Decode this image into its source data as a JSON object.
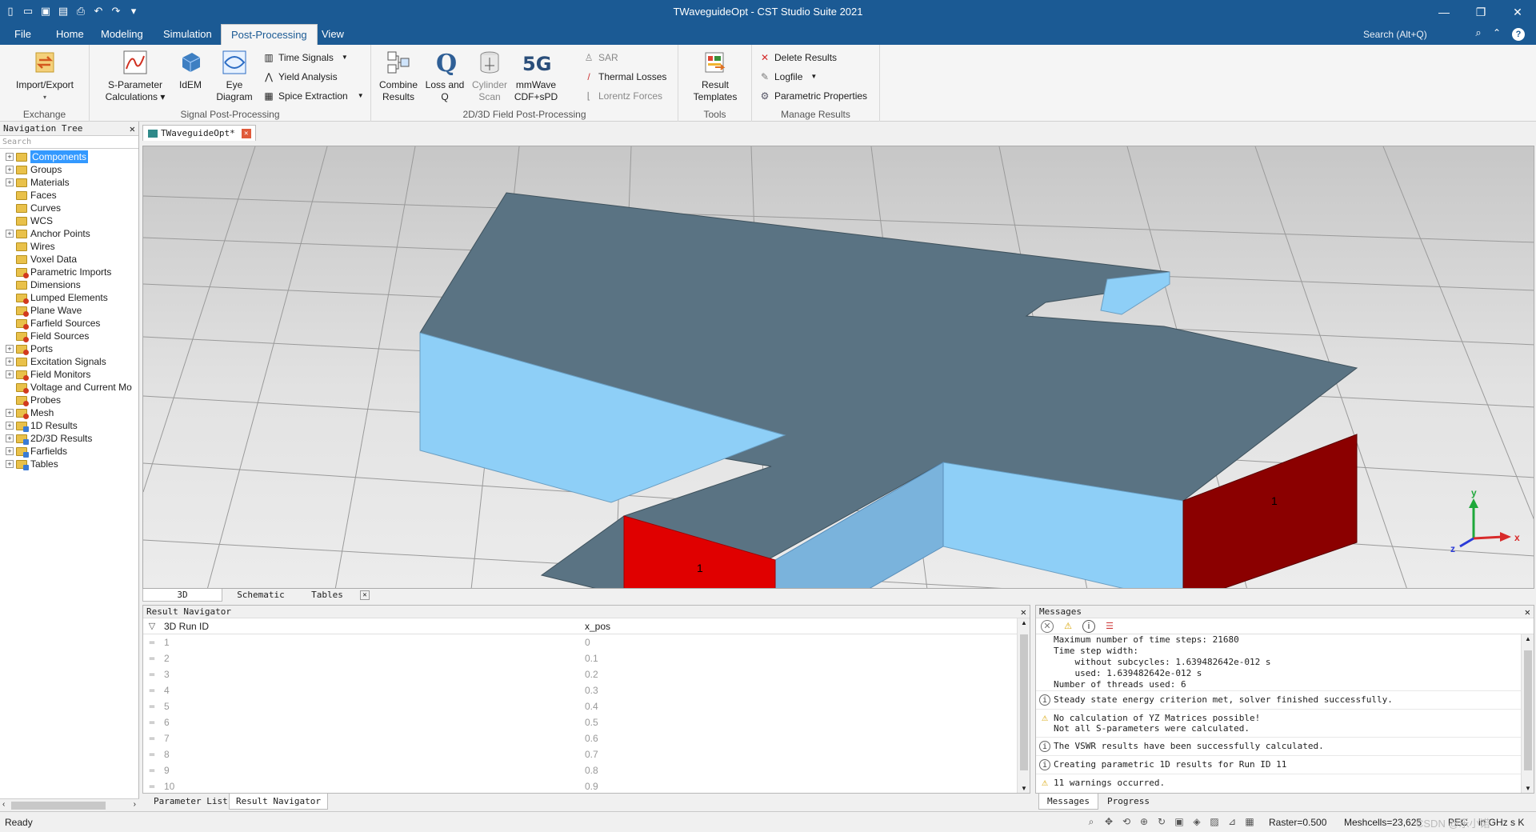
{
  "window": {
    "title": "TWaveguideOpt - CST Studio Suite 2021",
    "qat_icons": [
      "new-icon",
      "open-icon",
      "save-icon",
      "save-all-icon",
      "print-icon",
      "undo-icon",
      "redo-icon",
      "customize-icon"
    ],
    "controls": {
      "minimize": "—",
      "restore": "❐",
      "close": "✕"
    }
  },
  "menu": {
    "tabs": [
      "File",
      "Home",
      "Modeling",
      "Simulation",
      "Post-Processing",
      "View"
    ],
    "active": "Post-Processing",
    "search_placeholder": "Search (Alt+Q)",
    "help": "?"
  },
  "ribbon": {
    "exchange": {
      "import_export": [
        "Import/Export"
      ],
      "label": "Exchange"
    },
    "signal": {
      "sparam": [
        "S-Parameter",
        "Calculations ▾"
      ],
      "idem": [
        "IdEM"
      ],
      "eye": [
        "Eye",
        "Diagram"
      ],
      "time_signals": "Time Signals",
      "yield_analysis": "Yield Analysis",
      "spice_extraction": "Spice Extraction",
      "label": "Signal Post-Processing"
    },
    "field": {
      "combine": [
        "Combine",
        "Results"
      ],
      "loss": [
        "Loss and",
        "Q"
      ],
      "cylinder": [
        "Cylinder",
        "Scan"
      ],
      "mmwave": [
        "mmWave",
        "CDF+sPD"
      ],
      "sar": "SAR",
      "thermal": "Thermal Losses",
      "lorentz": "Lorentz Forces",
      "label": "2D/3D Field Post-Processing"
    },
    "tools": {
      "result_templates": [
        "Result",
        "Templates"
      ],
      "label": "Tools"
    },
    "manage": {
      "delete": "Delete Results",
      "logfile": "Logfile",
      "parametric": "Parametric Properties",
      "label": "Manage Results"
    }
  },
  "nav_tree": {
    "title": "Navigation Tree",
    "search_placeholder": "Search",
    "items": [
      {
        "label": "Components",
        "expandable": true,
        "selected": true,
        "badge": ""
      },
      {
        "label": "Groups",
        "expandable": true,
        "badge": ""
      },
      {
        "label": "Materials",
        "expandable": true,
        "badge": ""
      },
      {
        "label": "Faces",
        "expandable": false,
        "badge": ""
      },
      {
        "label": "Curves",
        "expandable": false,
        "badge": ""
      },
      {
        "label": "WCS",
        "expandable": false,
        "badge": ""
      },
      {
        "label": "Anchor Points",
        "expandable": true,
        "badge": ""
      },
      {
        "label": "Wires",
        "expandable": false,
        "badge": ""
      },
      {
        "label": "Voxel Data",
        "expandable": false,
        "badge": ""
      },
      {
        "label": "Parametric Imports",
        "expandable": false,
        "badge": "red"
      },
      {
        "label": "Dimensions",
        "expandable": false,
        "badge": ""
      },
      {
        "label": "Lumped Elements",
        "expandable": false,
        "badge": "red"
      },
      {
        "label": "Plane Wave",
        "expandable": false,
        "badge": "red"
      },
      {
        "label": "Farfield Sources",
        "expandable": false,
        "badge": "red"
      },
      {
        "label": "Field Sources",
        "expandable": false,
        "badge": "red"
      },
      {
        "label": "Ports",
        "expandable": true,
        "badge": "red"
      },
      {
        "label": "Excitation Signals",
        "expandable": true,
        "badge": ""
      },
      {
        "label": "Field Monitors",
        "expandable": true,
        "badge": "red"
      },
      {
        "label": "Voltage and Current Mo",
        "expandable": false,
        "badge": "red"
      },
      {
        "label": "Probes",
        "expandable": false,
        "badge": "red"
      },
      {
        "label": "Mesh",
        "expandable": true,
        "badge": "red"
      },
      {
        "label": "1D Results",
        "expandable": true,
        "badge": "blue"
      },
      {
        "label": "2D/3D Results",
        "expandable": true,
        "badge": "blue"
      },
      {
        "label": "Farfields",
        "expandable": true,
        "badge": "blue"
      },
      {
        "label": "Tables",
        "expandable": true,
        "badge": "blue"
      }
    ]
  },
  "document_tab": {
    "label": "TWaveguideOpt*"
  },
  "viewport": {
    "port_labels": [
      "1",
      "1"
    ],
    "axis": {
      "x": "x",
      "y": "y",
      "z": "z"
    },
    "colors": {
      "top": "#5a7383",
      "side_light": "#8ecff7",
      "side_mid": "#7ab3dc",
      "port_red": "#e00000",
      "port_dark": "#8b0000"
    }
  },
  "view_tabs": [
    "3D",
    "Schematic",
    "Tables"
  ],
  "result_navigator": {
    "title": "Result Navigator",
    "columns": [
      "3D Run ID",
      "x_pos"
    ],
    "rows": [
      [
        "1",
        "0"
      ],
      [
        "2",
        "0.1"
      ],
      [
        "3",
        "0.2"
      ],
      [
        "4",
        "0.3"
      ],
      [
        "5",
        "0.4"
      ],
      [
        "6",
        "0.5"
      ],
      [
        "7",
        "0.6"
      ],
      [
        "8",
        "0.7"
      ],
      [
        "9",
        "0.8"
      ],
      [
        "10",
        "0.9"
      ]
    ],
    "bottom_tabs": [
      "Parameter List",
      "Result Navigator"
    ]
  },
  "messages": {
    "title": "Messages",
    "log_lines": [
      "Maximum number of time steps: 21680",
      "Time step width:",
      "    without subcycles: 1.639482642e-012 s",
      "    used: 1.639482642e-012 s",
      "Number of threads used: 6"
    ],
    "entries": [
      {
        "type": "info",
        "lines": [
          "Steady state energy criterion met, solver finished successfully."
        ]
      },
      {
        "type": "warn",
        "lines": [
          "No calculation of YZ Matrices possible!",
          "Not all S-parameters were calculated."
        ]
      },
      {
        "type": "info",
        "lines": [
          "The VSWR results have been successfully calculated."
        ]
      },
      {
        "type": "info",
        "lines": [
          "Creating parametric 1D results for Run ID 11"
        ]
      },
      {
        "type": "warn",
        "lines": [
          "11 warnings occurred."
        ]
      }
    ],
    "bottom_tabs": [
      "Messages",
      "Progress"
    ]
  },
  "status": {
    "ready": "Ready",
    "raster": "Raster=0.500",
    "meshcells": "Meshcells=23,625",
    "pec": "PEC",
    "units": "in GHz s K",
    "watermark": "CSDN @乐小诺"
  }
}
